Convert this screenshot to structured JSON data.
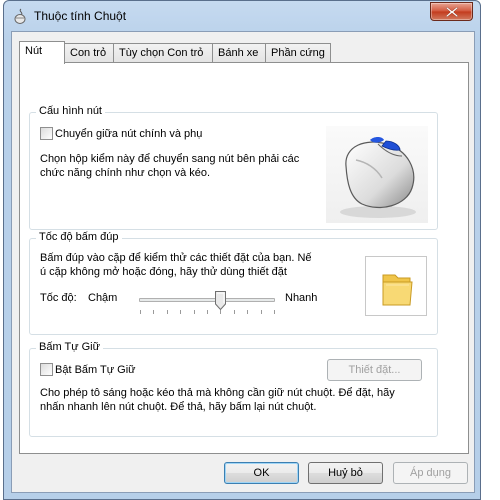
{
  "window": {
    "title": "Thuộc tính Chuột"
  },
  "tabs": [
    {
      "label": "Nút",
      "active": true
    },
    {
      "label": "Con trỏ",
      "active": false
    },
    {
      "label": "Tùy chọn Con trỏ",
      "active": false
    },
    {
      "label": "Bánh xe",
      "active": false
    },
    {
      "label": "Phần cứng",
      "active": false
    }
  ],
  "button_config": {
    "group_label": "Cấu hình nút",
    "checkbox_label": "Chuyển giữa nút chính và phụ",
    "checked": false,
    "description_line1": "Chọn hộp kiểm này để chuyển sang nút bên phải các",
    "description_line2": "chức năng chính như chọn và kéo."
  },
  "double_click": {
    "group_label": "Tốc độ bấm đúp",
    "description_line1": "Bấm đúp vào cặp để kiểm thử các thiết đặt của bạn. Nế",
    "description_line2": "ú cặp không mở hoặc đóng, hãy thử dùng thiết đặt",
    "speed_label": "Tốc độ:",
    "slow_label": "Chậm",
    "fast_label": "Nhanh",
    "speed_fraction": 0.6
  },
  "click_lock": {
    "group_label": "Bấm Tự Giữ",
    "checkbox_label": "Bật Bấm Tự Giữ",
    "checked": false,
    "settings_button": "Thiết đặt...",
    "description_line1": "Cho phép tô sáng hoặc kéo thả mà không cần giữ nút chuột. Để đặt, hãy",
    "description_line2": "nhấn nhanh lên nút chuột. Để thả, hãy bấm lại nút chuột."
  },
  "footer": {
    "ok": "OK",
    "cancel": "Huỷ bỏ",
    "apply": "Áp dụng"
  },
  "icons": {
    "title": "mouse-icon",
    "close": "close-icon",
    "illustration": "mouse-illustration",
    "test_folder": "folder-icon"
  },
  "colors": {
    "title_bar": "#b9d1ea",
    "close_button": "#c23a1c",
    "default_button_border": "#3c7fb1"
  }
}
